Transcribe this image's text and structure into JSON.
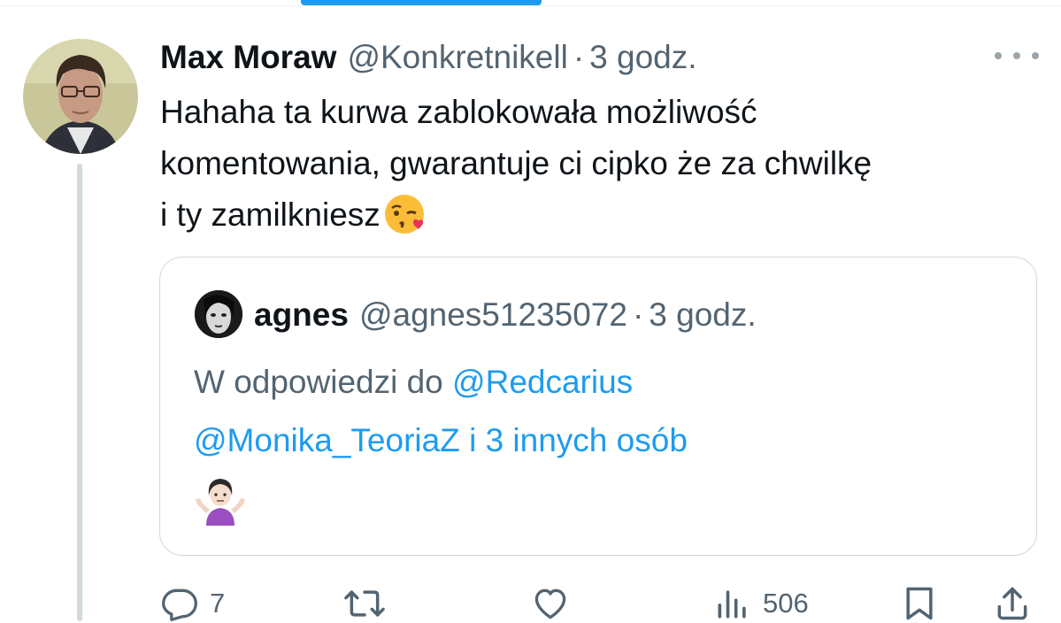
{
  "tweet": {
    "display_name": "Max Moraw",
    "handle": "@Konkretnikell",
    "separator": "·",
    "time": "3 godz.",
    "text_lines": [
      "Hahaha ta kurwa zablokowała możliwość",
      "komentowania, gwarantuje ci cipko że za chwilkę",
      "i ty zamilkniesz"
    ],
    "text_emoji": "kissing-face-with-heart-emoji"
  },
  "quote": {
    "display_name": "agnes",
    "handle": "@agnes51235072",
    "separator": "·",
    "time": "3 godz.",
    "reply_prefix": "W odpowiedzi do",
    "reply_mention_1": "@Redcarius",
    "reply_mention_2": "@Monika_TeoriaZ i 3 innych osób",
    "emoji": "woman-shrugging-emoji"
  },
  "actions": {
    "reply_count": "7",
    "views_count": "506",
    "icons": [
      "reply-icon",
      "retweet-icon",
      "like-icon",
      "views-icon",
      "bookmark-icon",
      "share-icon"
    ]
  },
  "colors": {
    "accent": "#1d9bf0",
    "text_primary": "#0f1419",
    "text_secondary": "#536471",
    "border": "#cfd9de"
  }
}
